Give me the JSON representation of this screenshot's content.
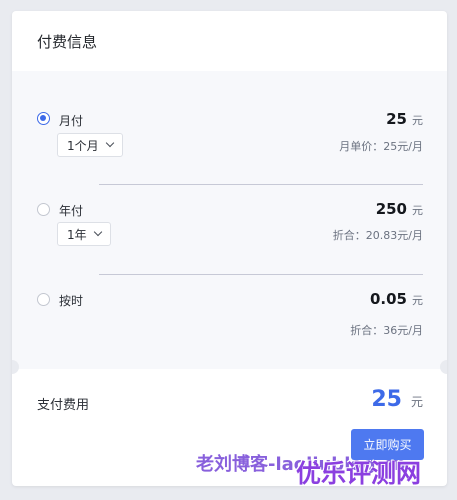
{
  "header": {
    "title": "付费信息"
  },
  "plans": [
    {
      "label": "月付",
      "selected": true,
      "price": "25",
      "unit": "元",
      "dropdown": "1个月",
      "note": "月单价：25元/月"
    },
    {
      "label": "年付",
      "selected": false,
      "price": "250",
      "unit": "元",
      "dropdown": "1年",
      "note": "折合：20.83元/月"
    },
    {
      "label": "按时",
      "selected": false,
      "price": "0.05",
      "unit": "元",
      "note": "折合：36元/月"
    }
  ],
  "payment": {
    "label": "支付费用",
    "amount": "25",
    "unit": "元",
    "buy_label": "立即购买"
  },
  "watermark": {
    "text": "老刘博客-laoliublog.cn",
    "logo": "优乐评测网"
  },
  "colors": {
    "accent": "#3d6ae8",
    "button": "#4e79f0",
    "page_bg": "#e9ebf0",
    "options_bg": "#f7f8fb"
  }
}
